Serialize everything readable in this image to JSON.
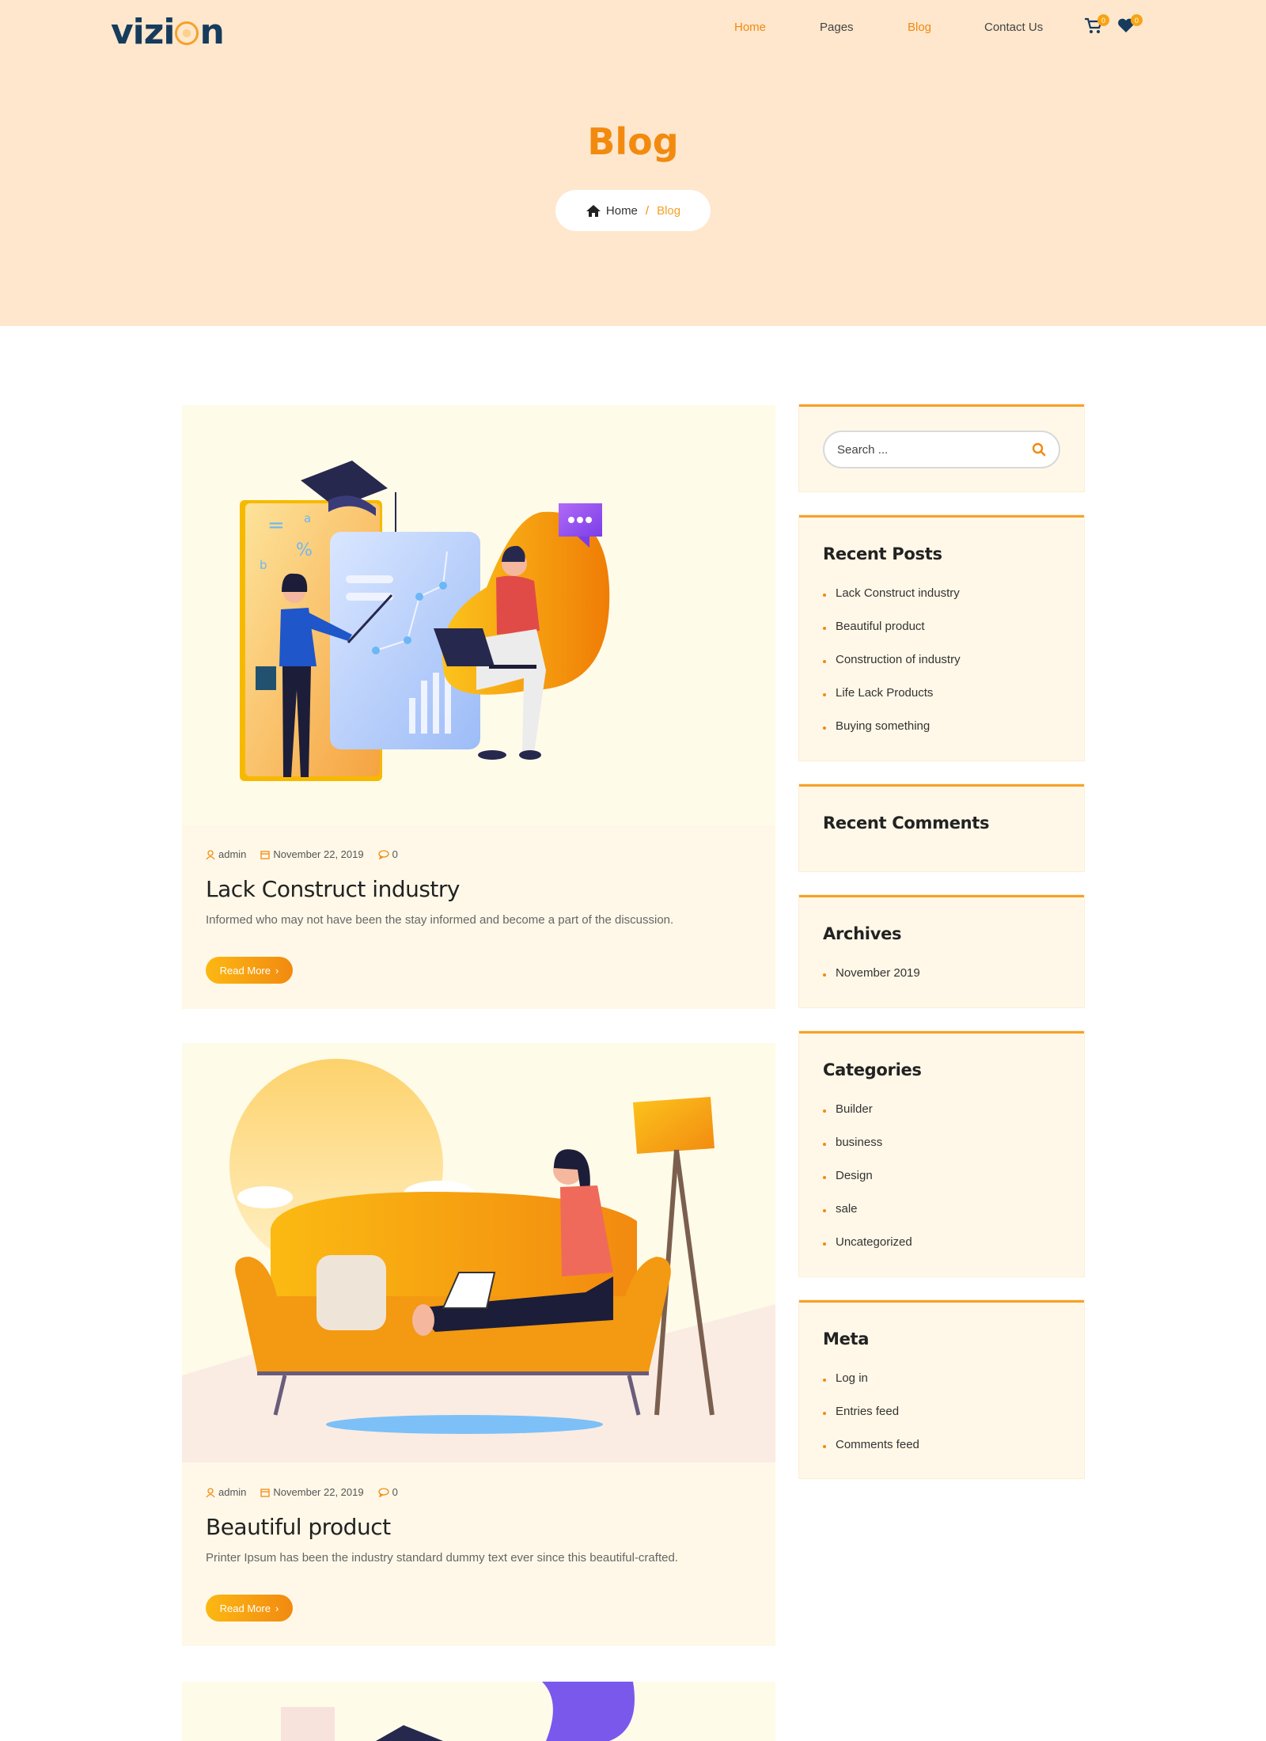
{
  "brand": {
    "logo_text_left": "vizi",
    "logo_text_right": "n"
  },
  "nav": {
    "items": [
      {
        "label": "Home",
        "active": true
      },
      {
        "label": "Pages",
        "active": false
      },
      {
        "label": "Blog",
        "active": true
      },
      {
        "label": "Contact Us",
        "active": false
      }
    ],
    "cart_count": "0",
    "wishlist_count": "0"
  },
  "hero": {
    "title": "Blog",
    "breadcrumb_home": "Home",
    "breadcrumb_sep": "/",
    "breadcrumb_current": "Blog"
  },
  "posts": [
    {
      "author": "admin",
      "date": "November 22, 2019",
      "comments": "0",
      "title": "Lack Construct industry",
      "excerpt": "Informed who may not have been the stay informed and become a part of the discussion.",
      "read_more": "Read More"
    },
    {
      "author": "admin",
      "date": "November 22, 2019",
      "comments": "0",
      "title": "Beautiful product",
      "excerpt": "Printer Ipsum has been the industry standard dummy text ever since this beautiful-crafted.",
      "read_more": "Read More"
    }
  ],
  "sidebar": {
    "search_placeholder": "Search ...",
    "recent_posts": {
      "title": "Recent Posts",
      "items": [
        "Lack Construct industry",
        "Beautiful product",
        "Construction of industry",
        "Life Lack Products",
        "Buying something"
      ]
    },
    "recent_comments": {
      "title": "Recent Comments"
    },
    "archives": {
      "title": "Archives",
      "items": [
        "November 2019"
      ]
    },
    "categories": {
      "title": "Categories",
      "items": [
        "Builder",
        "business",
        "Design",
        "sale",
        "Uncategorized"
      ]
    },
    "meta": {
      "title": "Meta",
      "items": [
        "Log in",
        "Entries feed",
        "Comments feed"
      ]
    }
  },
  "colors": {
    "accent": "#f28a10",
    "hero_bg": "#fee7cd",
    "card_bg": "#fff8e8",
    "dark": "#163b5c"
  }
}
